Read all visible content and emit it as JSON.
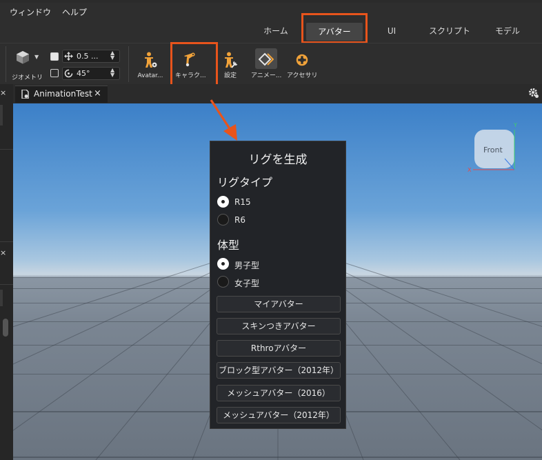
{
  "menubar": {
    "items": [
      "ウィンドウ",
      "ヘルプ"
    ]
  },
  "ribbon_tabs": [
    "ホーム",
    "アバター",
    "UI",
    "スクリプト",
    "モデル"
  ],
  "active_tab": "アバター",
  "toolbar": {
    "geometry_label": "ジオメトリ",
    "move_value": "0.5 ...",
    "rotate_value": "45°",
    "avatar_label": "Avatar...",
    "character_label": "キャラク...",
    "settings_label": "設定",
    "animation_label": "アニメー...",
    "accessory_label": "アクセサリ"
  },
  "doc_tab": {
    "title": "AnimationTest",
    "close": "×"
  },
  "navcube": {
    "face_label": "Front",
    "axis_y": "Y",
    "axis_x": "X"
  },
  "dialog": {
    "title": "リグを生成",
    "rig_type_heading": "リグタイプ",
    "rig_options": [
      {
        "label": "R15",
        "selected": true
      },
      {
        "label": "R6",
        "selected": false
      }
    ],
    "body_type_heading": "体型",
    "body_options": [
      {
        "label": "男子型",
        "selected": true
      },
      {
        "label": "女子型",
        "selected": false
      }
    ],
    "buttons": [
      "マイアバター",
      "スキンつきアバター",
      "Rthroアバター",
      "ブロック型アバター（2012年）",
      "メッシュアバター（2016）",
      "メッシュアバター（2012年）"
    ]
  },
  "colors": {
    "highlight": "#e8541c",
    "accent_icon": "#f0a23a"
  }
}
